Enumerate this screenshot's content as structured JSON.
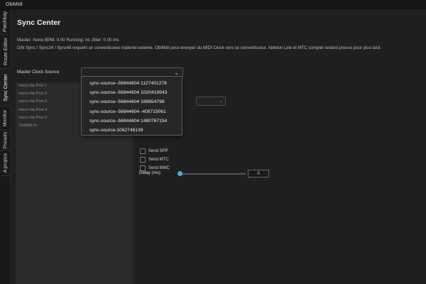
{
  "app": {
    "title": "ObiMidi"
  },
  "sidebar": {
    "tabs": [
      {
        "label": "Patchbay"
      },
      {
        "label": "Route Editor"
      },
      {
        "label": "Sync Center"
      },
      {
        "label": "Monitor"
      },
      {
        "label": "Presets"
      },
      {
        "label": "A propos"
      }
    ]
  },
  "page": {
    "title": "Sync Center",
    "status": "Master: None   BPM: 0.00   Running: no   Jitter: 0.00 ms",
    "info": "DIN Sync / Sync24 / Sync48 requiert un convertisseur materiel externe. ObiMidi peut envoyer du MIDI Clock vers ce convertisseur. Ableton Link et MTC complet restent prevus pour plus tard.",
    "master_clock_label": "Master Clock Source",
    "master_clock_value": ""
  },
  "ports": [
    "micro lite Port 1",
    "micro lite Port 2",
    "micro lite Port 3",
    "micro lite Port 4",
    "micro lite Port 5",
    "ObiMidi In"
  ],
  "dropdown_options": [
    "sync-source--56844604 1127401278",
    "sync-source--56844604 1020418943",
    "sync-source--56844604 169854798",
    "sync-source--56844604 -408715061",
    "sync-source--56844604 1480767154",
    "sync-source-1062746139"
  ],
  "options": {
    "send_spp": "Send SPP",
    "send_mtc": "Send MTC",
    "send_mmc": "Send MMC"
  },
  "delay": {
    "label": "Delay (ms)",
    "value": "0",
    "slider_fraction": 0
  },
  "colors": {
    "accent": "#4fa8e0",
    "background": "#1e1e1e"
  }
}
